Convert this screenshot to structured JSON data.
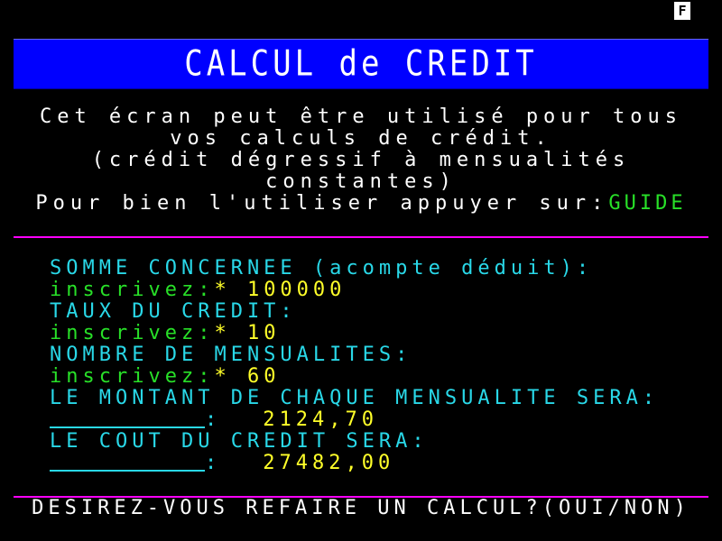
{
  "badge": "F",
  "title": "CALCUL de CREDIT",
  "intro": {
    "line1": "Cet écran peut être utilisé pour tous",
    "line2": "vos calculs de crédit.",
    "line3": "(crédit dégressif à mensualités",
    "line4": "constantes)",
    "line5_prefix": "Pour bien l'utiliser appuyer sur:",
    "guide": "GUIDE"
  },
  "form": {
    "somme_label": "SOMME CONCERNEE (acompte déduit):",
    "inscrivez": "inscrivez:",
    "somme_value": "* 100000",
    "taux_label": "TAUX DU CREDIT:",
    "taux_value": "* 10",
    "mensualites_label": "NOMBRE DE MENSUALITES:",
    "mensualites_value": "* 60",
    "montant_label": "LE MONTANT DE CHAQUE MENSUALITE SERA:",
    "colon": ":",
    "montant_value": "2124,70",
    "cout_label": "LE COUT DU CREDIT SERA:",
    "cout_value": "27482,00"
  },
  "footer": "DESIREZ-VOUS REFAIRE UN CALCUL?(OUI/NON)"
}
